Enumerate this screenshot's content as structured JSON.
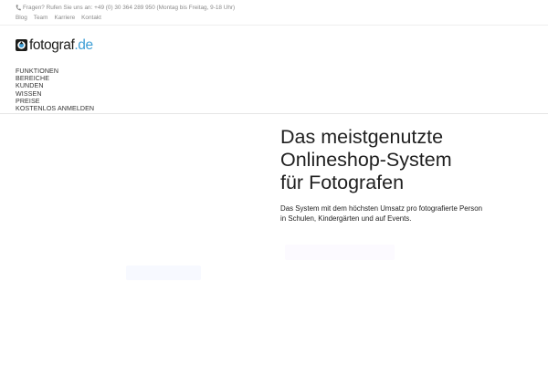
{
  "topbar": {
    "contact": "Fragen? Rufen Sie uns an: +49 (0) 30 364 289 950 (Montag bis Freitag, 9-18 Uhr)",
    "links": [
      "Blog",
      "Team",
      "Karriere",
      "Kontakt"
    ]
  },
  "logo": {
    "name": "fotograf",
    "tld": ".de"
  },
  "nav": {
    "items": [
      "FUNKTIONEN",
      "BEREICHE",
      "KUNDEN",
      "WISSEN",
      "PREISE",
      "KOSTENLOS ANMELDEN"
    ]
  },
  "hero": {
    "title_lines": [
      "Das meistgenutzte",
      "Onlineshop-System",
      "für Fotografen"
    ],
    "subtitle_lines": [
      "Das System mit dem höchsten Umsatz pro fotografierte Person",
      "in Schulen, Kindergärten und auf Events."
    ]
  },
  "icons": {
    "phone": "phone-icon",
    "logo": "camera-aperture-icon"
  },
  "colors": {
    "accent": "#3f9fd6",
    "text": "#1f1f1f",
    "muted": "#8a8a8a"
  }
}
